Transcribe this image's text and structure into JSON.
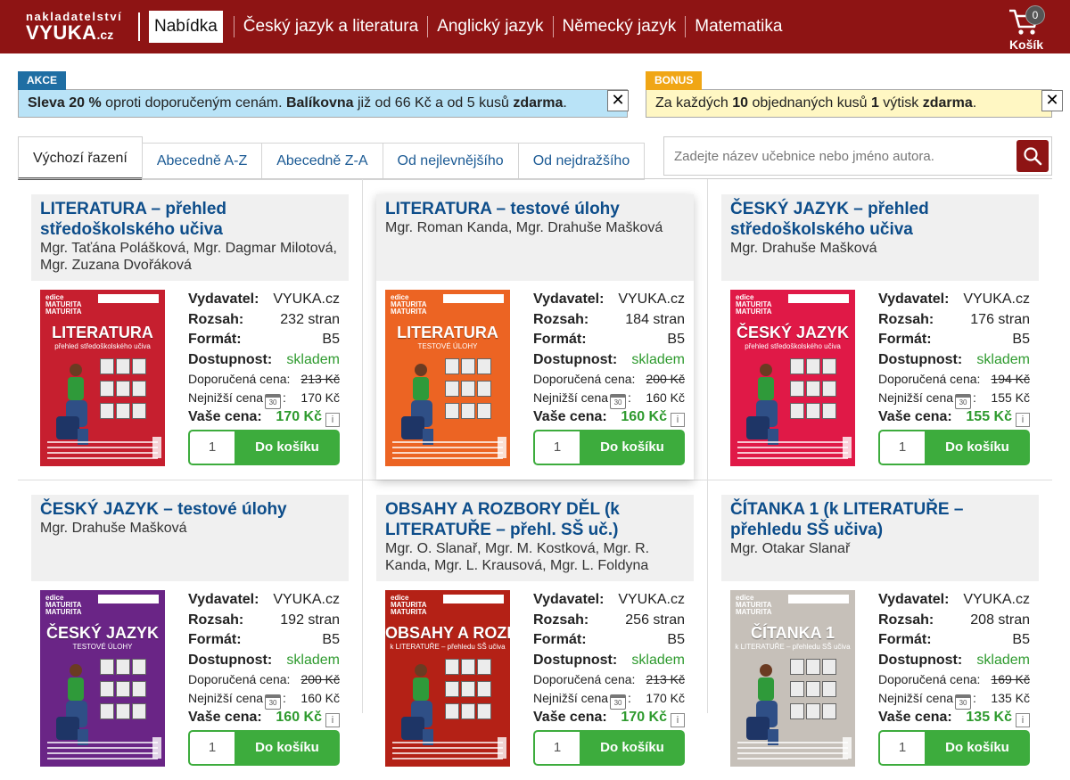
{
  "header": {
    "logo_top": "nakladatelství",
    "logo_main": "VYUKA",
    "logo_suffix": ".cz",
    "nav": [
      "Nabídka",
      "Český jazyk a literatura",
      "Anglický jazyk",
      "Německý jazyk",
      "Matematika"
    ],
    "cart_label": "Košík",
    "cart_count": "0"
  },
  "notices": {
    "akce": {
      "tag": "AKCE",
      "parts": [
        "Sleva 20 %",
        " oproti doporučeným cenám. ",
        "Balíkovna",
        " již od 66 Kč a od 5 kusů ",
        "zdarma",
        "."
      ],
      "close": "✕"
    },
    "bonus": {
      "tag": "BONUS",
      "parts": [
        "Za každých ",
        "10",
        " objednaných kusů ",
        "1",
        " výtisk ",
        "zdarma",
        "."
      ],
      "close": "✕"
    }
  },
  "sort_tabs": [
    "Výchozí řazení",
    "Abecedně A-Z",
    "Abecedně Z-A",
    "Od nejlevnějšího",
    "Od nejdražšího"
  ],
  "search": {
    "placeholder": "Zadejte název učebnice nebo jméno autora."
  },
  "labels": {
    "publisher": "Vydavatel:",
    "pages": "Rozsah:",
    "format": "Formát:",
    "availability": "Dostupnost:",
    "recommended": "Doporučená cena:",
    "lowest": "Nejnižší cena",
    "lowest_suffix": ":",
    "your_price": "Vaše cena:",
    "add_to_cart": "Do košíku",
    "calendar_num": "30",
    "info_icon": "i"
  },
  "products": [
    {
      "title": "LITERATURA – přehled středoškolského učiva",
      "authors": "Mgr. Taťána Polášková, Mgr. Dagmar Milotová, Mgr. Zuzana Dvořáková",
      "publisher": "VYUKA.cz",
      "pages": "232 stran",
      "format": "B5",
      "availability": "skladem",
      "recommended": "213 Kč",
      "lowest": "170 Kč",
      "price": "170 Kč",
      "qty": "1",
      "cover_title": "LITERATURA",
      "cover_sub": "přehled středoškolského učiva",
      "cover_color": "#c61f2f"
    },
    {
      "title": "LITERATURA – testové úlohy",
      "authors": "Mgr. Roman Kanda, Mgr. Drahuše Mašková",
      "publisher": "VYUKA.cz",
      "pages": "184 stran",
      "format": "B5",
      "availability": "skladem",
      "recommended": "200 Kč",
      "lowest": "160 Kč",
      "price": "160 Kč",
      "qty": "1",
      "cover_title": "LITERATURA",
      "cover_sub": "TESTOVÉ ÚLOHY",
      "cover_color": "#ec6423"
    },
    {
      "title": "ČESKÝ JAZYK – přehled středoškolského učiva",
      "authors": "Mgr. Drahuše Mašková",
      "publisher": "VYUKA.cz",
      "pages": "176 stran",
      "format": "B5",
      "availability": "skladem",
      "recommended": "194 Kč",
      "lowest": "155 Kč",
      "price": "155 Kč",
      "qty": "1",
      "cover_title": "ČESKÝ JAZYK",
      "cover_sub": "přehled středoškolského učiva",
      "cover_color": "#e01947"
    },
    {
      "title": "ČESKÝ JAZYK – testové úlohy",
      "authors": "Mgr. Drahuše Mašková",
      "publisher": "VYUKA.cz",
      "pages": "192 stran",
      "format": "B5",
      "availability": "skladem",
      "recommended": "200 Kč",
      "lowest": "160 Kč",
      "price": "160 Kč",
      "qty": "1",
      "cover_title": "ČESKÝ JAZYK",
      "cover_sub": "TESTOVÉ ÚLOHY",
      "cover_color": "#6a2586"
    },
    {
      "title": "OBSAHY A ROZBORY DĚL (k LITERATUŘE – přehl. SŠ uč.)",
      "authors": "Mgr. O. Slanař, Mgr. M. Kostková, Mgr. R. Kanda, Mgr. L. Krausová, Mgr. L. Foldyna",
      "publisher": "VYUKA.cz",
      "pages": "256 stran",
      "format": "B5",
      "availability": "skladem",
      "recommended": "213 Kč",
      "lowest": "170 Kč",
      "price": "170 Kč",
      "qty": "1",
      "cover_title": "OBSAHY A ROZBORY DĚL",
      "cover_sub": "k LITERATUŘE – přehledu SŠ učiva",
      "cover_color": "#b42116"
    },
    {
      "title": "ČÍTANKA 1 (k LITERATUŘE – přehledu SŠ učiva)",
      "authors": "Mgr. Otakar Slanař",
      "publisher": "VYUKA.cz",
      "pages": "208 stran",
      "format": "B5",
      "availability": "skladem",
      "recommended": "169 Kč",
      "lowest": "135 Kč",
      "price": "135 Kč",
      "qty": "1",
      "cover_title": "ČÍTANKA 1",
      "cover_sub": "k LITERATUŘE – přehledu SŠ učiva",
      "cover_color": "#c6c0b9"
    }
  ]
}
